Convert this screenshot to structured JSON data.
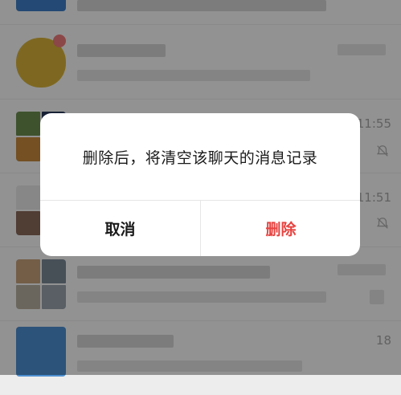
{
  "chat_list": {
    "rows": [
      {
        "time": ""
      },
      {
        "time": ""
      },
      {
        "time": "11:55"
      },
      {
        "time": "11:51"
      },
      {
        "time": ""
      },
      {
        "time": "18"
      }
    ]
  },
  "dialog": {
    "message": "删除后，将清空该聊天的消息记录",
    "cancel_label": "取消",
    "delete_label": "删除"
  },
  "colors": {
    "delete_accent": "#e64340",
    "overlay": "rgba(0,0,0,0.42)"
  },
  "icons": {
    "mute": "bell-off-icon"
  }
}
